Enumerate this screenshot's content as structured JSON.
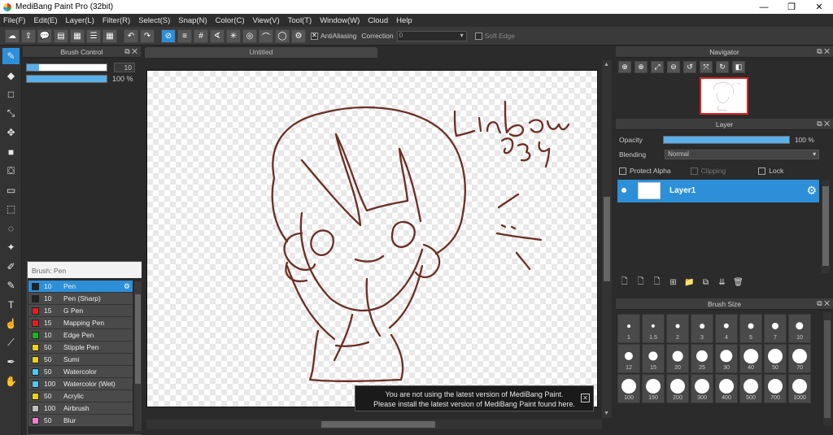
{
  "window": {
    "title": "MediBang Paint Pro (32bit)",
    "min": "—",
    "max": "❐",
    "close": "✕"
  },
  "menu": [
    "File(F)",
    "Edit(E)",
    "Layer(L)",
    "Filter(R)",
    "Select(S)",
    "Snap(N)",
    "Color(C)",
    "View(V)",
    "Tool(T)",
    "Window(W)",
    "Cloud",
    "Help"
  ],
  "toolbar": {
    "antialiasing_label": "AntiAliasing",
    "correction_label": "Correction",
    "correction_value": "0",
    "soft_edge_label": "Soft Edge"
  },
  "brush_control": {
    "title": "Brush Control",
    "size": "10",
    "opacity": "100 %",
    "size_fraction": 0.15,
    "opacity_fraction": 1.0
  },
  "brush_list": {
    "header": "Brush: Pen",
    "items": [
      {
        "size": "10",
        "name": "Pen",
        "color": "#222222",
        "selected": true
      },
      {
        "size": "10",
        "name": "Pen (Sharp)",
        "color": "#222222"
      },
      {
        "size": "15",
        "name": "G Pen",
        "color": "#e02020"
      },
      {
        "size": "15",
        "name": "Mapping Pen",
        "color": "#e02020"
      },
      {
        "size": "10",
        "name": "Edge Pen",
        "color": "#20b020"
      },
      {
        "size": "50",
        "name": "Stipple Pen",
        "color": "#e8d020"
      },
      {
        "size": "50",
        "name": "Sumi",
        "color": "#e8d020"
      },
      {
        "size": "50",
        "name": "Watercolor",
        "color": "#50c8f0"
      },
      {
        "size": "100",
        "name": "Watercolor (Wet)",
        "color": "#50c8f0"
      },
      {
        "size": "50",
        "name": "Acrylic",
        "color": "#e8d020"
      },
      {
        "size": "100",
        "name": "Airbrush",
        "color": "#c0c0c0"
      },
      {
        "size": "50",
        "name": "Blur",
        "color": "#f080d0"
      }
    ]
  },
  "document": {
    "tab": "Untitled"
  },
  "toast": {
    "line1": "You are not using the latest version of MediBang Paint.",
    "line2": "Please install the latest version of MediBang Paint found here.",
    "close": "✕"
  },
  "navigator": {
    "title": "Navigator"
  },
  "layer_panel": {
    "title": "Layer",
    "opacity_label": "Opacity",
    "opacity_value": "100 %",
    "blending_label": "Blending",
    "blending_value": "Normal",
    "protect_alpha": "Protect Alpha",
    "clipping": "Clipping",
    "lock": "Lock",
    "layer_name": "Layer1"
  },
  "brush_size": {
    "title": "Brush Size",
    "sizes": [
      "1",
      "1.5",
      "2",
      "3",
      "4",
      "5",
      "7",
      "10",
      "12",
      "15",
      "20",
      "25",
      "30",
      "40",
      "50",
      "70",
      "100",
      "150",
      "200",
      "300",
      "400",
      "500",
      "700",
      "1000"
    ]
  },
  "colors": {
    "accent": "#2d8fd8",
    "sketch": "#6b2e23"
  }
}
